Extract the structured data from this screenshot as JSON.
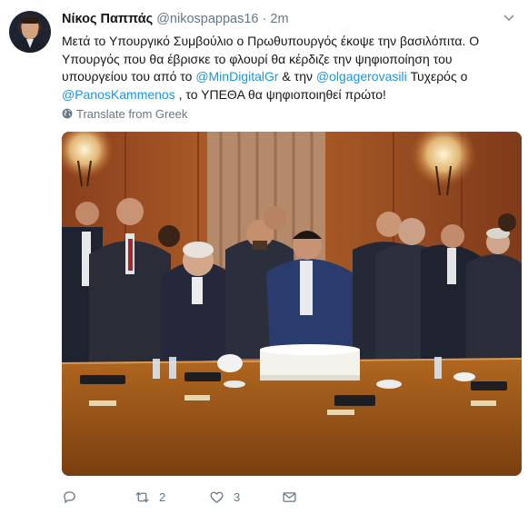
{
  "tweet": {
    "author_name": "Νίκος Παππάς",
    "handle": "@nikospappas16",
    "separator": "·",
    "time": "2m",
    "text": {
      "part1": "Μετά το Υπουργικό Συμβούλιο ο Πρωθυπουργός έκοψε την βασιλόπιτα. Ο Υπουργός που θα έβρισκε το φλουρί θα κέρδιζε την ψηφιοποίηση του υπουργείου του από το ",
      "mention1": "@MinDigitalGr",
      "part2": " & την ",
      "mention2": "@olgagerovasili",
      "part3": " Τυχερός ο ",
      "mention3": "@PanosKammenos",
      "part4": " , το ΥΠΕΘΑ θα ψηφιοποιηθεί πρώτο!"
    },
    "translate_label": "Translate from Greek",
    "photo_icon": "photo-of-cabinet-meeting-cake-cutting"
  },
  "actions": {
    "reply_icon": "reply-icon",
    "reply_count": "",
    "retweet_icon": "retweet-icon",
    "retweet_count": "2",
    "like_icon": "heart-icon",
    "like_count": "3",
    "dm_icon": "envelope-icon"
  },
  "colors": {
    "link": "#1b95e0",
    "secondary_text": "#657786",
    "primary_text": "#14171a",
    "background": "#ffffff"
  }
}
